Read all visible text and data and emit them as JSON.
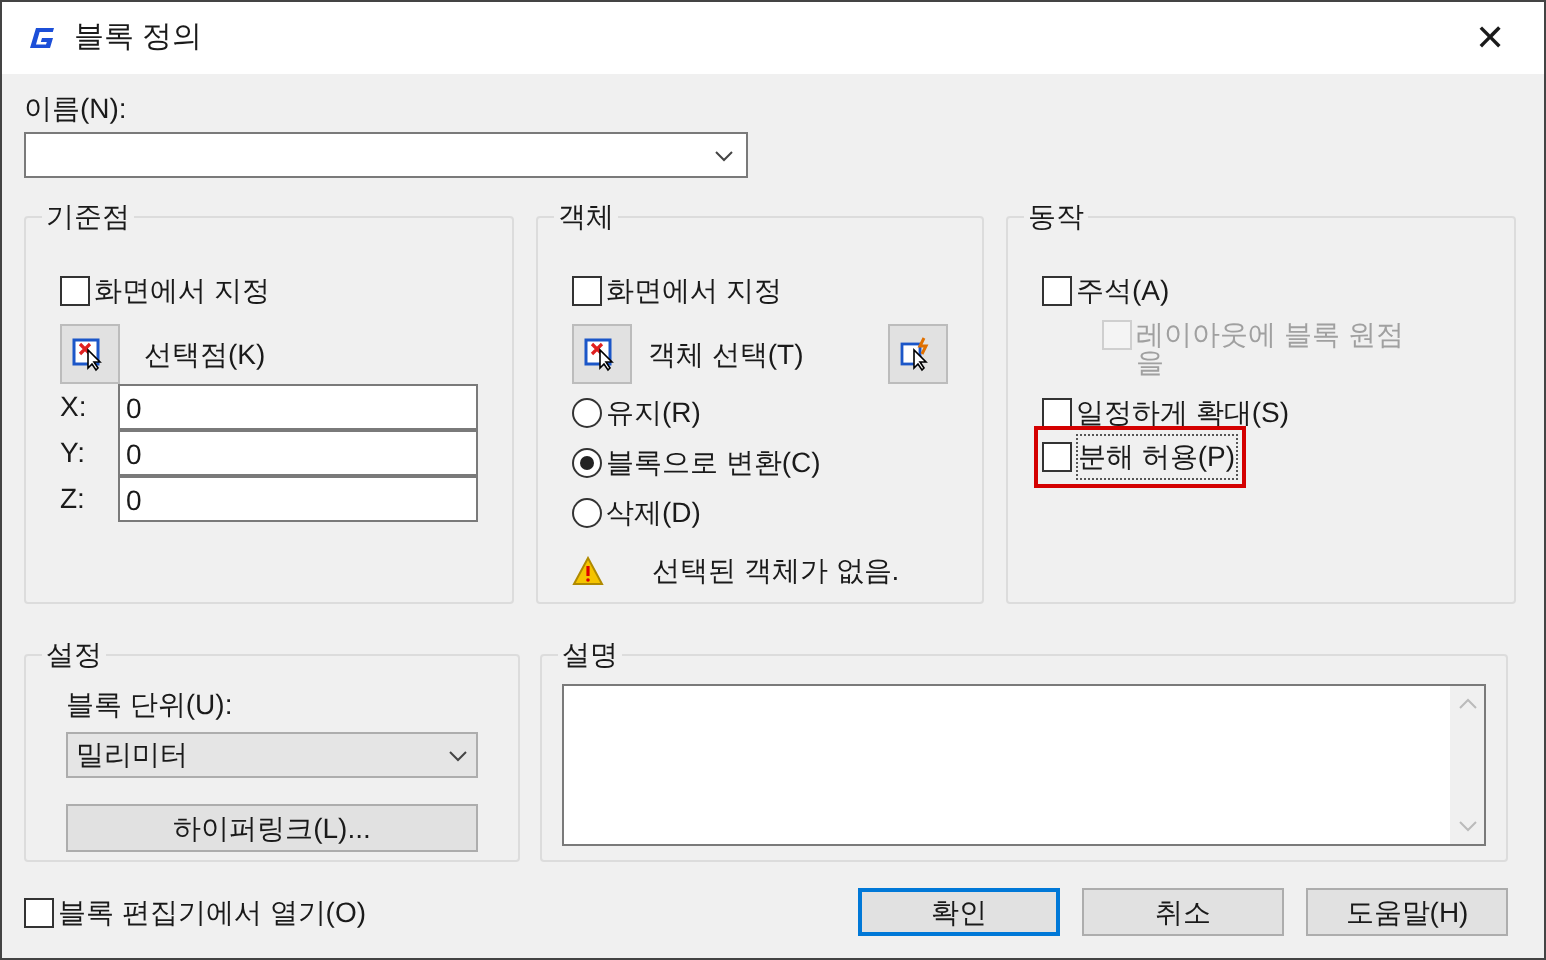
{
  "window": {
    "title": "블록 정의",
    "close": "✕"
  },
  "name_field": {
    "label": "이름(N):"
  },
  "base_point": {
    "title": "기준점",
    "specify_on_screen": {
      "label": "화면에서 지정",
      "checked": false
    },
    "pick_label": "선택점(K)",
    "coords": [
      {
        "label": "X:",
        "value": "0"
      },
      {
        "label": "Y:",
        "value": "0"
      },
      {
        "label": "Z:",
        "value": "0"
      }
    ]
  },
  "objects": {
    "title": "객체",
    "specify_on_screen": {
      "label": "화면에서 지정",
      "checked": false
    },
    "select_label": "객체 선택(T)",
    "options": [
      {
        "label": "유지(R)",
        "selected": false
      },
      {
        "label": "블록으로 변환(C)",
        "selected": true
      },
      {
        "label": "삭제(D)",
        "selected": false
      }
    ],
    "warning": "선택된 객체가 없음."
  },
  "behavior": {
    "title": "동작",
    "items": [
      {
        "label": "주석(A)",
        "checked": false,
        "disabled": false,
        "indent": false,
        "highlighted": false
      },
      {
        "label": "레이아웃에 블록 원점을",
        "checked": false,
        "disabled": true,
        "indent": true,
        "highlighted": false
      },
      {
        "label": "일정하게 확대(S)",
        "checked": false,
        "disabled": false,
        "indent": false,
        "highlighted": false
      },
      {
        "label": "분해 허용(P)",
        "checked": false,
        "disabled": false,
        "indent": false,
        "highlighted": true
      }
    ]
  },
  "settings": {
    "title": "설정",
    "unit_label": "블록 단위(U):",
    "unit_value": "밀리미터",
    "hyperlink_button": "하이퍼링크(L)..."
  },
  "description": {
    "title": "설명"
  },
  "open_in_editor": {
    "label": "블록 편집기에서 열기(O)",
    "checked": false
  },
  "buttons": [
    {
      "label": "확인",
      "default": true
    },
    {
      "label": "취소",
      "default": false
    },
    {
      "label": "도움말(H)",
      "default": false
    }
  ]
}
